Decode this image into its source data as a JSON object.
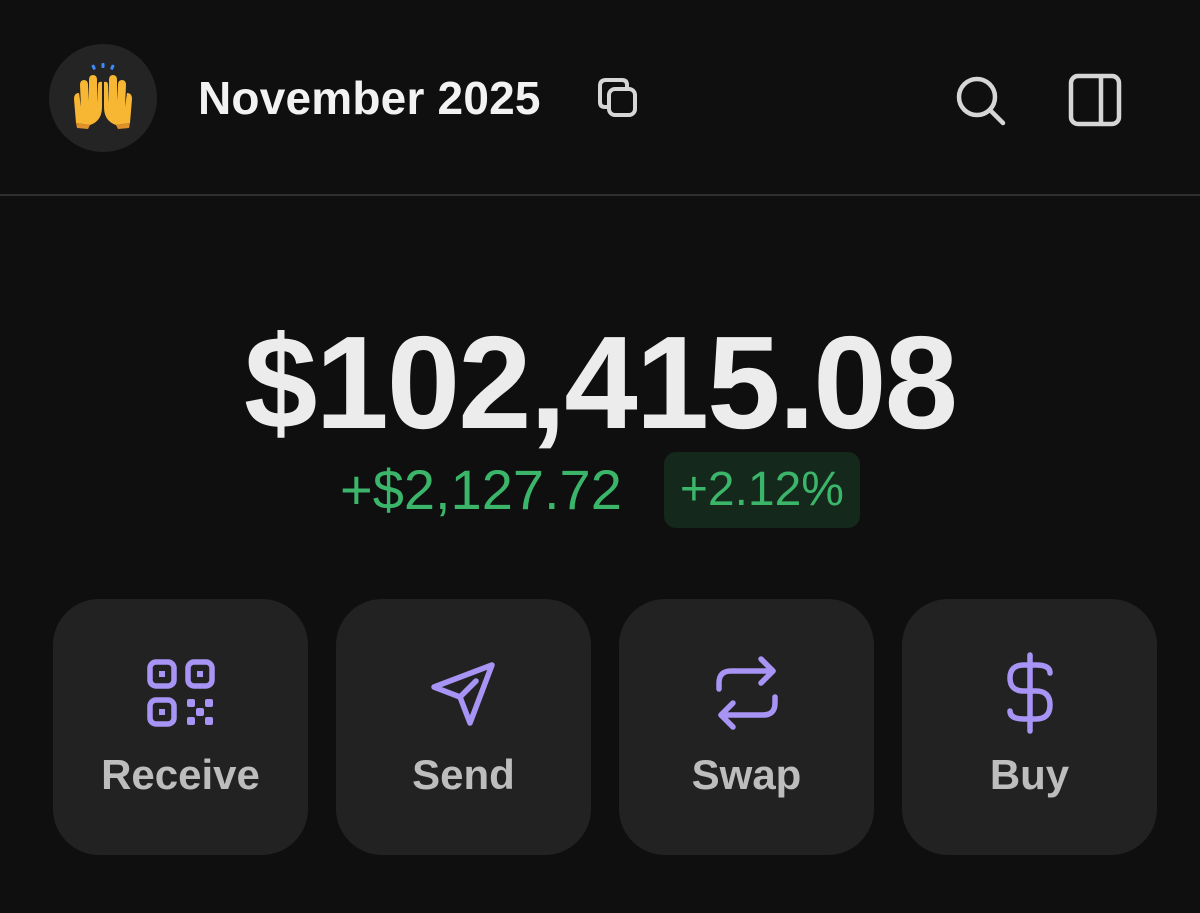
{
  "header": {
    "avatar_icon": "raising-hands-emoji-icon",
    "account_name": "November 2025",
    "copy_icon": "copy-icon",
    "search_icon": "search-icon",
    "panel_icon": "sidebar-panel-icon"
  },
  "portfolio": {
    "balance": "$102,415.08",
    "change_amount": "+$2,127.72",
    "change_percent": "+2.12%"
  },
  "actions": [
    {
      "label": "Receive",
      "icon": "qr-code-icon"
    },
    {
      "label": "Send",
      "icon": "send-icon"
    },
    {
      "label": "Swap",
      "icon": "swap-icon"
    },
    {
      "label": "Buy",
      "icon": "dollar-icon"
    }
  ],
  "colors": {
    "background": "#0f0f0f",
    "accent_purple": "#a794f5",
    "positive_green": "#3bb56a",
    "button_bg": "#222222"
  }
}
